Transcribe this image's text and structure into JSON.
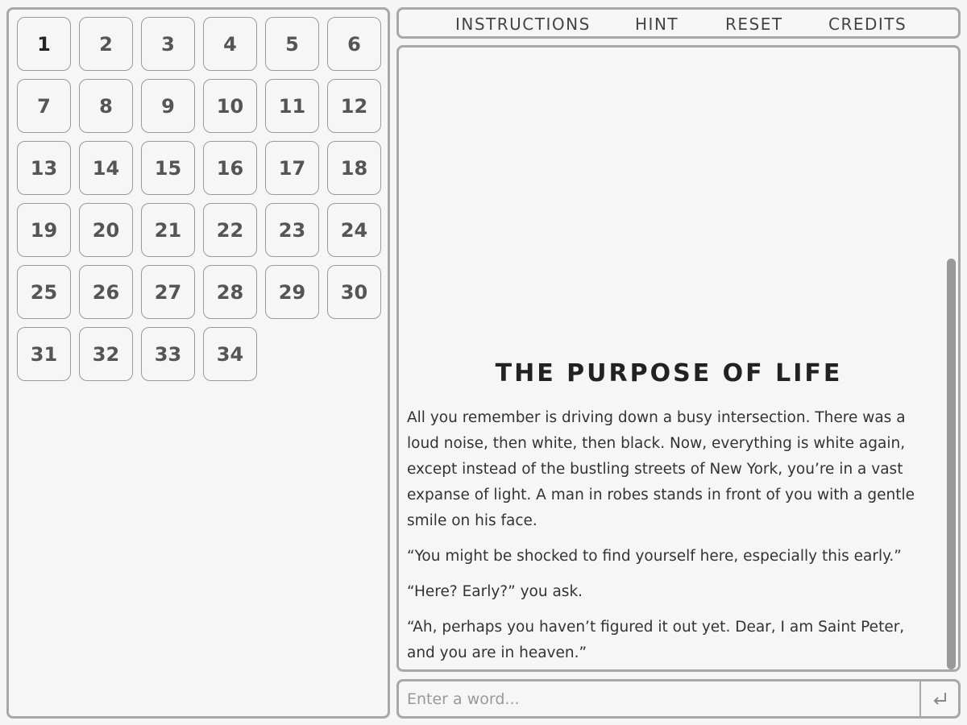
{
  "levels": [
    "1",
    "2",
    "3",
    "4",
    "5",
    "6",
    "7",
    "8",
    "9",
    "10",
    "11",
    "12",
    "13",
    "14",
    "15",
    "16",
    "17",
    "18",
    "19",
    "20",
    "21",
    "22",
    "23",
    "24",
    "25",
    "26",
    "27",
    "28",
    "29",
    "30",
    "31",
    "32",
    "33",
    "34"
  ],
  "current_level": "1",
  "menu": {
    "instructions": "INSTRUCTIONS",
    "hint": "HINT",
    "reset": "RESET",
    "credits": "CREDITS"
  },
  "story": {
    "title": "THE PURPOSE OF LIFE",
    "paragraphs": [
      "All you remember is driving down a busy intersection. There was a loud noise, then white, then black. Now, everything is white again, except instead of the bustling streets of New York, you’re in a vast expanse of light. A man in robes stands in front of you with a gentle smile on his face.",
      "“You might be shocked to find yourself here, especially this early.”",
      "“Here? Early?” you ask.",
      "“Ah, perhaps you haven’t figured it out yet. Dear, I am Saint Peter, and you are in heaven.”"
    ]
  },
  "input": {
    "placeholder": "Enter a word...",
    "value": ""
  },
  "icons": {
    "enter": "return-arrow-icon"
  }
}
